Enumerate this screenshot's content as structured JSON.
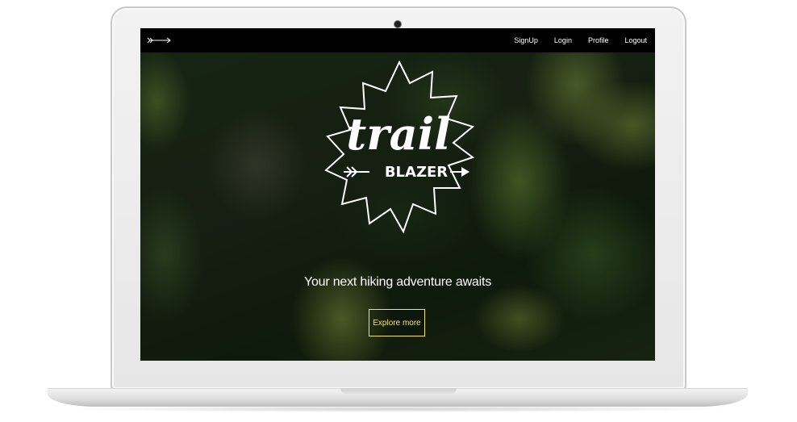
{
  "nav": {
    "links": [
      "SignUp",
      "Login",
      "Profile",
      "Logout"
    ]
  },
  "logo": {
    "word_top": "trail",
    "word_bottom": "BLAZER"
  },
  "hero": {
    "tagline": "Your next hiking adventure awaits",
    "cta_label": "Explore more"
  },
  "colors": {
    "navbar": "#000000",
    "accent": "#f1e27a",
    "text": "#ffffff"
  },
  "icons": {
    "nav_logo": "arrow-icon",
    "webcam": "camera-icon"
  }
}
